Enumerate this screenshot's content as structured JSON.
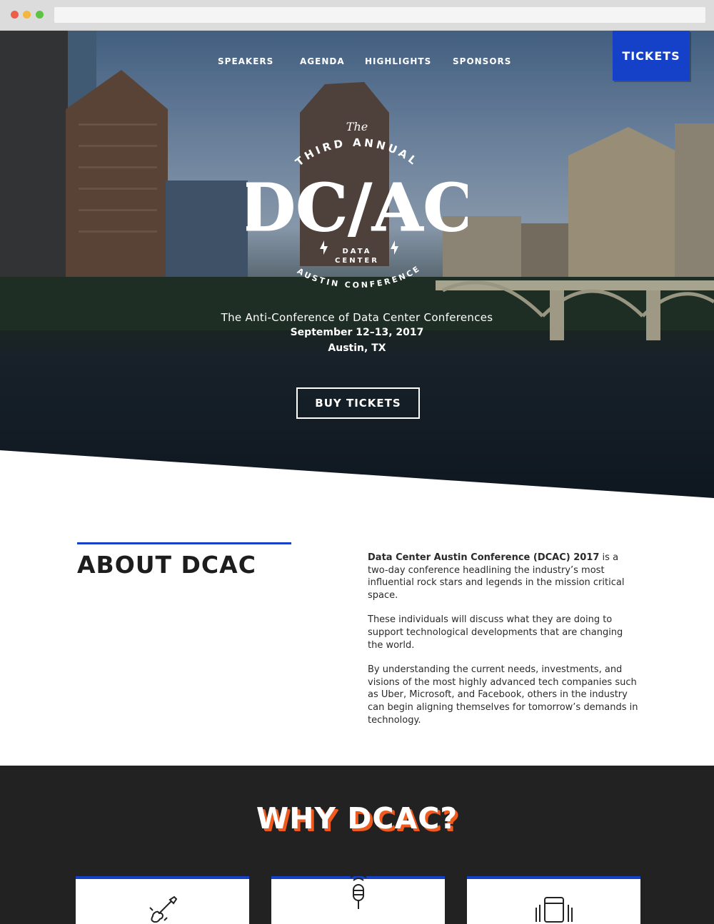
{
  "nav": {
    "items": [
      "SPEAKERS",
      "AGENDA",
      "HIGHLIGHTS",
      "SPONSORS"
    ],
    "tickets_label": "TICKETS"
  },
  "hero": {
    "logo": {
      "the": "The",
      "arc_top": "THIRD ANNUAL",
      "main": "DC/AC",
      "data": "DATA",
      "center": "CENTER",
      "arc_bottom": "AUSTIN CONFERENCE"
    },
    "tagline": "The Anti-Conference of Data Center Conferences",
    "dates": "September 12–13, 2017",
    "location": "Austin, TX",
    "buy_label": "BUY TICKETS"
  },
  "about": {
    "title": "ABOUT DCAC",
    "lead_bold": "Data Center Austin Conference (DCAC) 2017",
    "lead_rest": " is a two-day conference headlining the industry’s most influential rock stars and legends in the mission critical space.",
    "para2": "These individuals will discuss what they are doing to support technological developments that are changing the world.",
    "para3": "By understanding the current needs, investments, and visions of the most highly advanced tech companies such as Uber, Microsoft, and Facebook, others in the industry can begin aligning themselves for tomorrow’s demands in technology."
  },
  "why": {
    "title": "WHY DCAC?",
    "cards": [
      {
        "icon": "guitar-icon"
      },
      {
        "icon": "microphone-icon"
      },
      {
        "icon": "amplifier-icon"
      }
    ]
  },
  "colors": {
    "accent_blue": "#1540c8",
    "accent_orange": "#ef5a1e",
    "dark_bg": "#222222"
  }
}
